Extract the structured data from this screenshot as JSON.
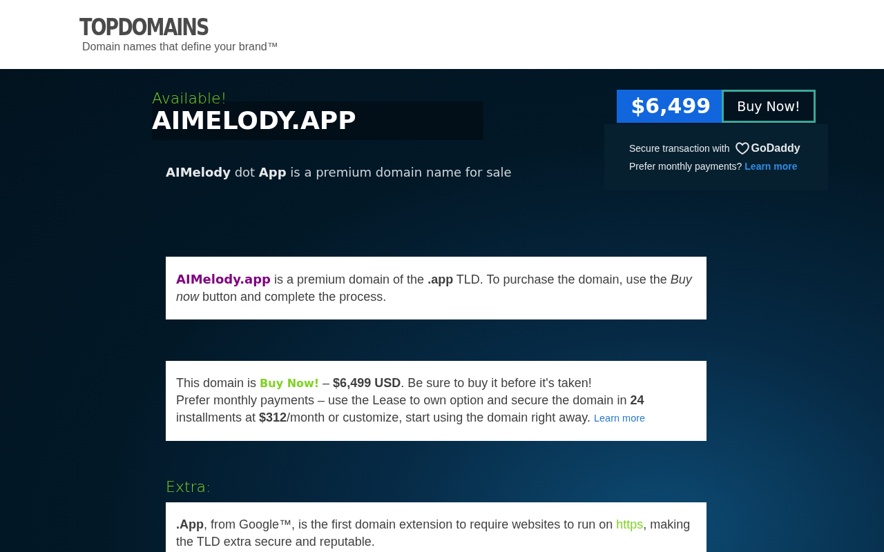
{
  "header": {
    "logo": "TOPDOMAINS",
    "tagline": "Domain names that define your brand™"
  },
  "hero": {
    "status": "Available!",
    "domain": "AIMELODY.APP",
    "subtitle": "**AIMelody** dot **App** is a premium domain name for sale"
  },
  "purchase": {
    "price": "$6,499",
    "buy_button": "Buy Now!",
    "secure_text": "Secure transaction with",
    "provider": "GoDaddy",
    "monthly_text": "Prefer monthly payments?",
    "learn_more": "Learn more"
  },
  "cards": [
    {
      "paragraphs": [
        [
          {
            "kind": "brand",
            "text": "AIMelody.app"
          },
          {
            "kind": "plain",
            "text": " is a premium domain of the **.app** TLD. To purchase the domain, use the *Buy now* button and complete the process."
          }
        ]
      ]
    },
    {
      "paragraphs": [
        [
          {
            "kind": "plain",
            "text": "This domain is "
          },
          {
            "kind": "accent",
            "text": "Buy Now!"
          },
          {
            "kind": "plain",
            "text": " – **$6,499 USD**. Be sure to buy it before it's taken!"
          }
        ],
        [
          {
            "kind": "plain",
            "text": "Prefer monthly payments – use the Lease to own option and secure the domain in **24** installments at **$312**/month or customize, start using the domain right away. "
          },
          {
            "kind": "link",
            "text": "Learn more"
          }
        ]
      ]
    }
  ],
  "extra": {
    "heading": "Extra:",
    "paragraphs": [
      [
        {
          "kind": "plain",
          "text": "**.App**, from Google™, is the first domain extension to require websites to run on "
        },
        {
          "kind": "green-link",
          "text": "https"
        },
        {
          "kind": "plain",
          "text": ", making the TLD extra secure and reputable."
        }
      ]
    ]
  }
}
